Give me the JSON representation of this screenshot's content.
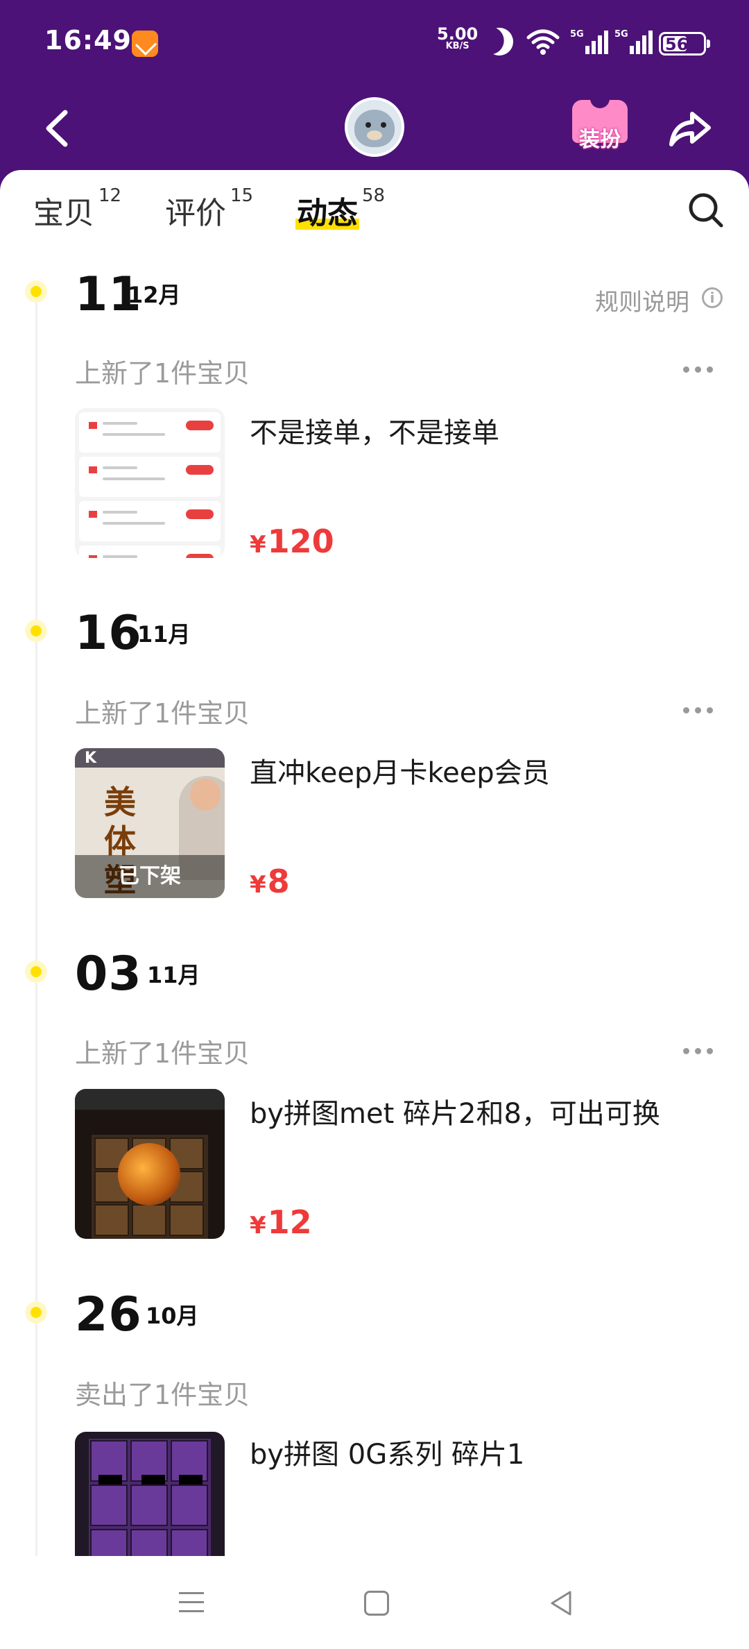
{
  "status_bar": {
    "time": "16:49",
    "net_speed": "5.00",
    "net_unit": "KB/S",
    "signal_labels": [
      "5G",
      "5G"
    ],
    "battery": "56"
  },
  "header": {
    "outfit_label": "装扮"
  },
  "tabs": [
    {
      "label": "宝贝",
      "count": "12",
      "active": false
    },
    {
      "label": "评价",
      "count": "15",
      "active": false
    },
    {
      "label": "动态",
      "count": "58",
      "active": true
    }
  ],
  "rules_label": "规则说明",
  "timeline": [
    {
      "day": "11",
      "month": "12月",
      "event": "上新了1件宝贝",
      "title": "不是接单，不是接单",
      "currency": "¥",
      "price": "120",
      "removed_label": ""
    },
    {
      "day": "16",
      "month": "11月",
      "event": "上新了1件宝贝",
      "title": "直冲keep月卡keep会员",
      "currency": "¥",
      "price": "8",
      "removed_label": "已下架"
    },
    {
      "day": "03",
      "month": "11月",
      "event": "上新了1件宝贝",
      "title": "by拼图met 碎片2和8，可出可换",
      "currency": "¥",
      "price": "12",
      "removed_label": ""
    },
    {
      "day": "26",
      "month": "10月",
      "event": "卖出了1件宝贝",
      "title": "by拼图 0G系列 碎片1",
      "currency": "",
      "price": "",
      "removed_label": ""
    }
  ],
  "thumb_text": {
    "keep_logo": "K",
    "keep_big": "美体塑"
  },
  "colors": {
    "header_bg": "#4c1277",
    "accent_yellow": "#ffe100",
    "price_red": "#ee3a3a"
  }
}
